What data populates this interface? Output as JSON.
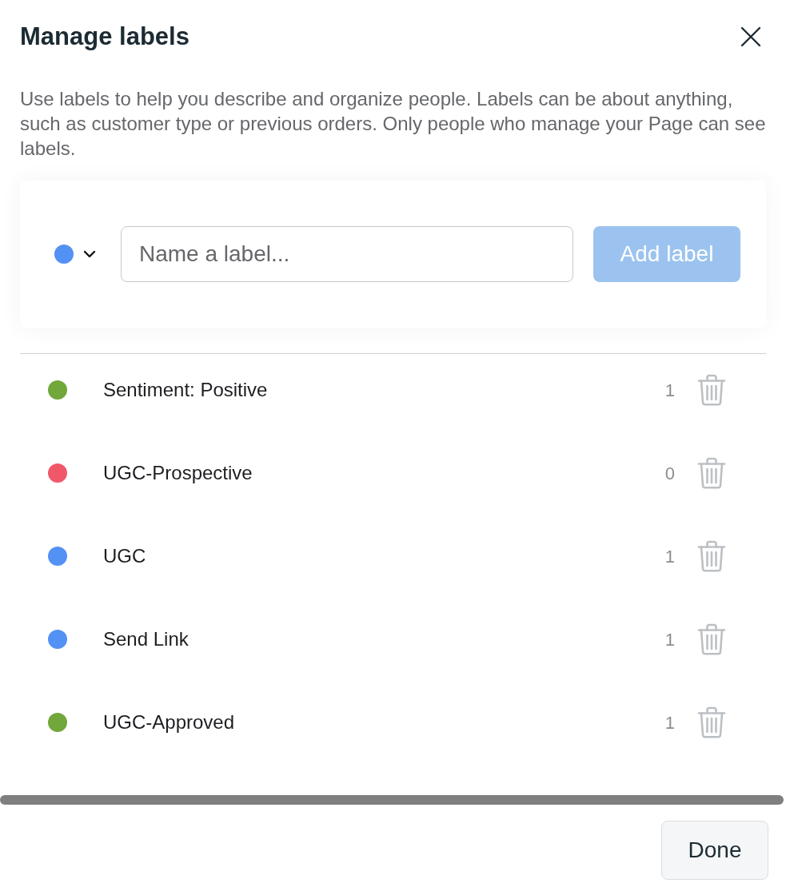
{
  "dialog": {
    "title": "Manage labels",
    "description": "Use labels to help you describe and organize people. Labels can be about anything, such as customer type or previous orders. Only people who manage your Page can see labels."
  },
  "new_label": {
    "color": "#5491f5",
    "placeholder": "Name a label...",
    "add_button": {
      "label": "Add label",
      "disabled": true
    }
  },
  "labels": [
    {
      "name": "Sentiment: Positive",
      "color": "#72a73b",
      "count": "1"
    },
    {
      "name": "UGC-Prospective",
      "color": "#f0586a",
      "count": "0"
    },
    {
      "name": "UGC",
      "color": "#5491f5",
      "count": "1"
    },
    {
      "name": "Send Link",
      "color": "#5491f5",
      "count": "1"
    },
    {
      "name": "UGC-Approved",
      "color": "#72a73b",
      "count": "1"
    }
  ],
  "footer": {
    "done_button": "Done"
  }
}
